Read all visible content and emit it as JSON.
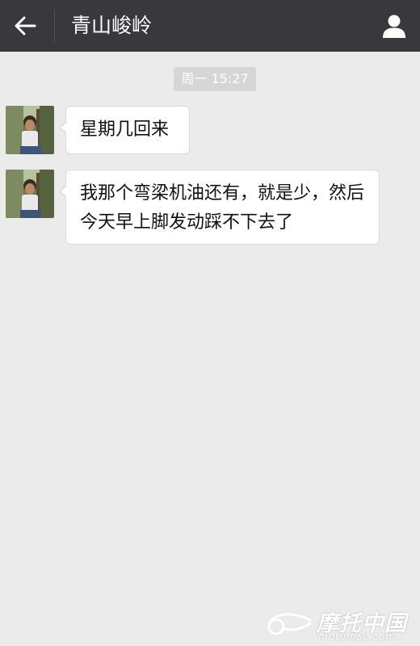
{
  "header": {
    "back_icon": "arrow-left-icon",
    "title": "青山峻岭",
    "profile_icon": "person-icon"
  },
  "timestamp": "周一 15:27",
  "messages": [
    {
      "sender": "contact",
      "text": "星期几回来"
    },
    {
      "sender": "contact",
      "text": "我那个弯梁机油还有，就是少，然后今天早上脚发动踩不下去了"
    }
  ],
  "watermark": {
    "logo_text": "摩托中国",
    "site_text": "motomsc.com"
  },
  "colors": {
    "header_bg": "#39393d",
    "chat_bg": "#ebebeb",
    "bubble_bg": "#ffffff",
    "time_badge_bg": "#d6d6d6"
  }
}
